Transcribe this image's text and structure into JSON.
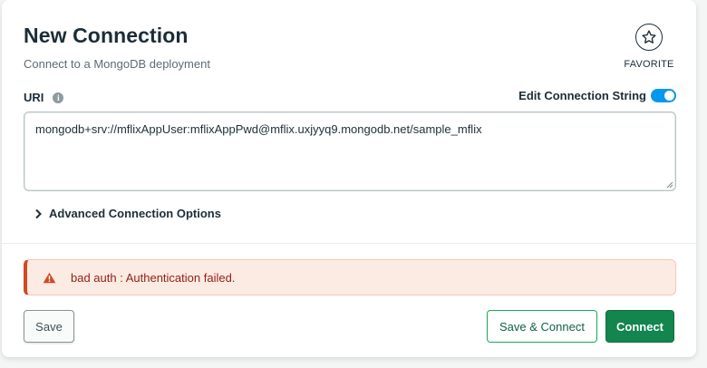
{
  "header": {
    "title": "New Connection",
    "subtitle": "Connect to a MongoDB deployment",
    "favorite_label": "FAVORITE",
    "favorite_icon": "star-outline-icon"
  },
  "uri": {
    "label": "URI",
    "info_icon": "info-icon",
    "edit_toggle_label": "Edit Connection String",
    "edit_toggle_on": true,
    "value": "mongodb+srv://mflixAppUser:mflixAppPwd@mflix.uxjyyq9.mongodb.net/sample_mflix"
  },
  "advanced": {
    "label": "Advanced Connection Options",
    "icon": "chevron-right-icon"
  },
  "error": {
    "message": "bad auth : Authentication failed.",
    "icon": "warning-icon",
    "color": "#cf4a22"
  },
  "footer": {
    "save_label": "Save",
    "save_connect_label": "Save & Connect",
    "connect_label": "Connect"
  },
  "colors": {
    "accent_green": "#13854e",
    "toggle_blue": "#0498ec",
    "error_bg": "#fcebe2"
  }
}
